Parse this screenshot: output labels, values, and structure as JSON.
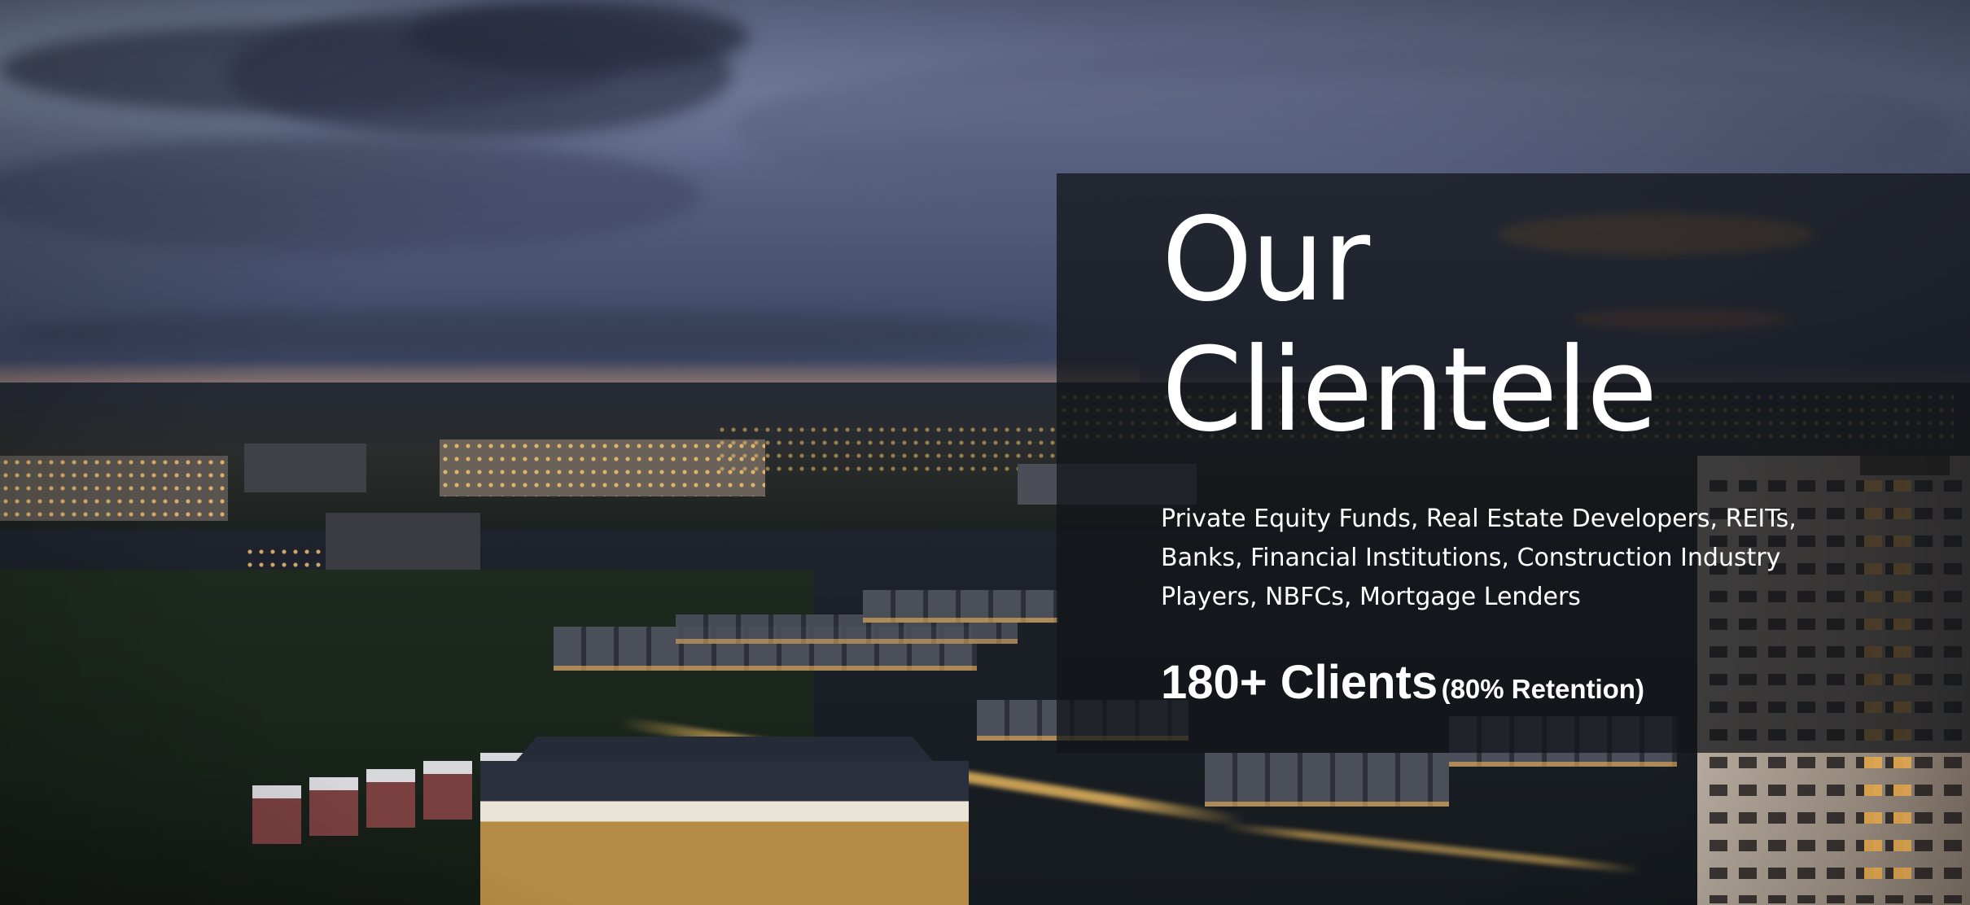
{
  "hero": {
    "title_line_1": "Our",
    "title_line_2": "Clientele",
    "description": "Private Equity Funds, Real Estate Developers, REITs, Banks, Financial Institutions, Construction Industry Players, NBFCs, Mortgage Lenders",
    "stat_main": "180+ Clients",
    "stat_sub": "(80% Retention)"
  },
  "background": {
    "scene": "aerial dusk cityscape with cloudy sky, lit residential buildings and high-rise tower"
  },
  "colors": {
    "overlay": "#121418",
    "text": "#ffffff"
  }
}
